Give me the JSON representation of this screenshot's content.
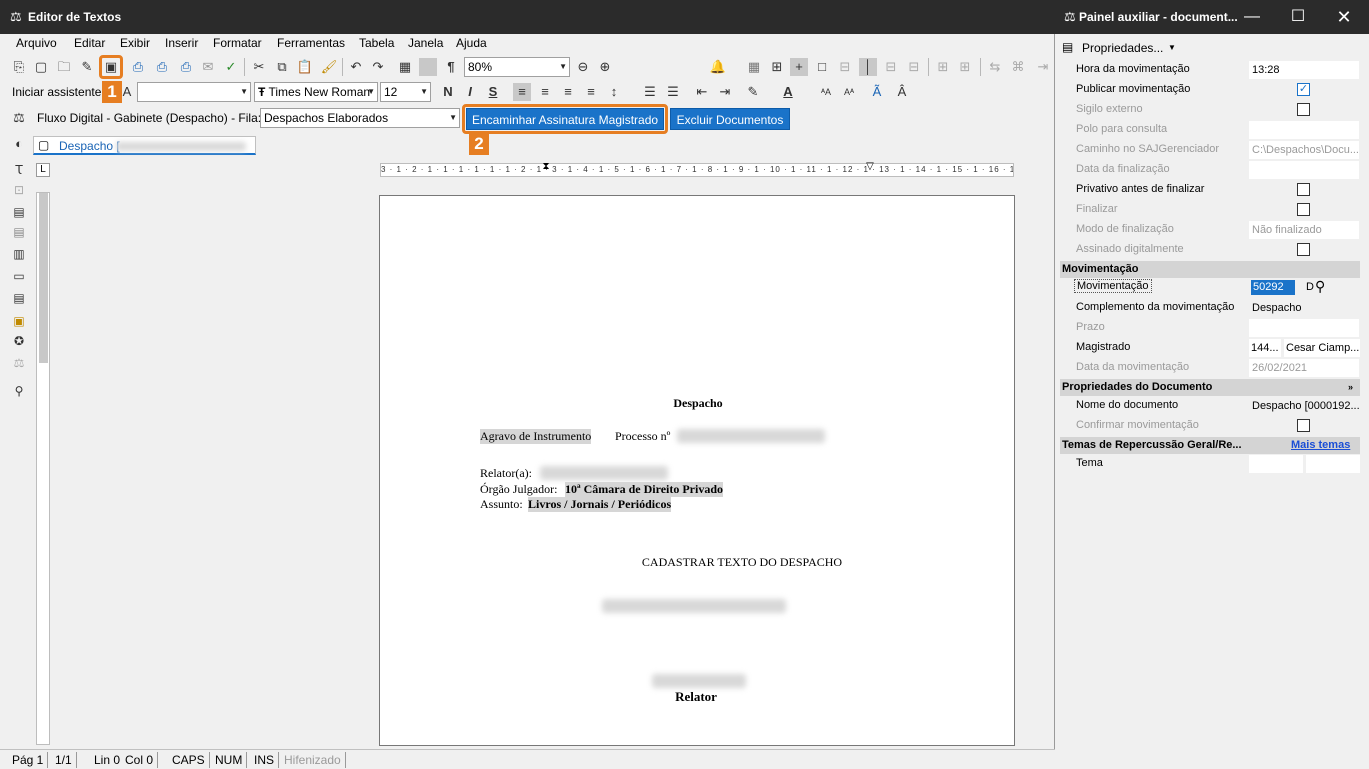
{
  "editor": {
    "title": "Editor de Textos",
    "menu": [
      "Arquivo",
      "Editar",
      "Exibir",
      "Inserir",
      "Formatar",
      "Ferramentas",
      "Tabela",
      "Janela",
      "Ajuda"
    ],
    "zoom": "80%",
    "assistant_label": "Iniciar assistente",
    "font_name": "Times New Roman",
    "font_size": "12",
    "bold": "N",
    "italic": "I",
    "underline": "S",
    "flow_label": "Fluxo Digital - Gabinete (Despacho) - Fila:",
    "queue_value": "Despachos Elaborados",
    "btn_forward": "Encaminhar Assinatura Magistrado",
    "btn_delete": "Excluir Documentos",
    "doc_tab": "Despacho [",
    "badge1": "1",
    "badge2": "2",
    "ruler_text": "3 · 1 · 2 · 1 · 1 · 1 · 1 · 1 · 1 · 2 · 1 · 3 · 1 · 4 · 1 · 5 · 1 · 6 · 1 · 7 · 1 · 8 · 1 · 9 · 1 · 10 · 1 · 11 · 1 · 12 · 1 · 13 · 1 · 14 · 1 · 15 · 1 · 16 · 1 · 17 ·",
    "document": {
      "heading": "Despacho",
      "case_type": "Agravo de Instrumento",
      "process_label": "Processo nº",
      "rapporteur_label": "Relator(a):",
      "court_label": "Órgão Julgador:",
      "court_value": "10ª Câmara de Direito Privado",
      "subject_label": "Assunto:",
      "subject_value": "Livros / Jornais / Periódicos",
      "body": "CADASTRAR TEXTO DO DESPACHO",
      "signature": "Relator"
    },
    "status": [
      "Pág 1",
      "1/1",
      "Lin 0",
      "Col 0",
      "CAPS",
      "NUM",
      "INS",
      "Hifenizado"
    ]
  },
  "panel": {
    "title": "Painel auxiliar - document...",
    "properties_label": "Propriedades...",
    "rows_top": [
      {
        "label": "Hora da movimentação",
        "value": "13:28",
        "type": "text",
        "disabled": false
      },
      {
        "label": "Publicar movimentação",
        "value": "",
        "type": "checked",
        "disabled": false
      },
      {
        "label": "Sigilo externo",
        "value": "",
        "type": "check",
        "disabled": true
      },
      {
        "label": "Polo para consulta",
        "value": "",
        "type": "text",
        "disabled": true
      },
      {
        "label": "Caminho no SAJGerenciador",
        "value": "C:\\Despachos\\Docu...",
        "type": "text",
        "disabled": true
      },
      {
        "label": "Data da finalização",
        "value": "",
        "type": "text",
        "disabled": true
      },
      {
        "label": "Privativo antes de finalizar",
        "value": "",
        "type": "check",
        "disabled": false
      },
      {
        "label": "Finalizar",
        "value": "",
        "type": "check",
        "disabled": true
      },
      {
        "label": "Modo de finalização",
        "value": "Não finalizado",
        "type": "text",
        "disabled": true
      },
      {
        "label": "Assinado digitalmente",
        "value": "",
        "type": "check",
        "disabled": true
      }
    ],
    "section_mov": "Movimentação",
    "mov_label": "Movimentação",
    "mov_value": "50292",
    "mov_suffix": "D",
    "comp_label": "Complemento da movimentação",
    "comp_value": "Despacho",
    "prazo_label": "Prazo",
    "mag_label": "Magistrado",
    "mag_code": "144...",
    "mag_name": "Cesar Ciamp...",
    "datamov_label": "Data da movimentação",
    "datamov_value": "26/02/2021",
    "section_doc": "Propriedades do Documento",
    "docname_label": "Nome do documento",
    "docname_value": "Despacho [0000192...",
    "confirm_label": "Confirmar movimentação",
    "section_temas": "Temas de Repercussão Geral/Re...",
    "more_themes": "Mais temas",
    "tema_label": "Tema"
  }
}
